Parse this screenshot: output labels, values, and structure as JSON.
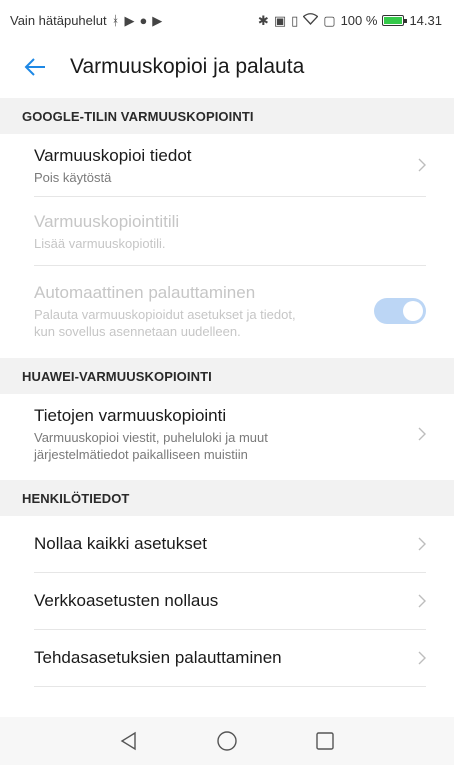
{
  "status_bar": {
    "left_text": "Vain hätäpuhelut",
    "left_icons": [
      "usb-icon",
      "notification-icon",
      "vpn-icon",
      "notification-icon"
    ],
    "right_icons": [
      "bluetooth-icon",
      "nfc-icon",
      "vibrate-icon",
      "wifi-icon",
      "battery-saver-icon"
    ],
    "battery_text": "100 %",
    "battery_color": "#35c94a",
    "time": "14.31"
  },
  "app_bar": {
    "title": "Varmuuskopioi ja palauta",
    "back_icon": "back-arrow-icon",
    "accent": "#1e88e5"
  },
  "sections": [
    {
      "header": "GOOGLE-TILIN VARMUUSKOPIOINTI",
      "items": [
        {
          "title": "Varmuuskopioi tiedot",
          "subtitle": "Pois käytöstä",
          "enabled": true,
          "trailing": "chevron"
        },
        {
          "title": "Varmuuskopiointitili",
          "subtitle": "Lisää varmuuskopiotili.",
          "enabled": false,
          "trailing": "none"
        },
        {
          "title": "Automaattinen palauttaminen",
          "subtitle_line1": "Palauta varmuuskopioidut asetukset ja tiedot,",
          "subtitle_line2": "kun sovellus asennetaan uudelleen.",
          "enabled": false,
          "trailing": "toggle",
          "toggle_on": true
        }
      ]
    },
    {
      "header": "HUAWEI-VARMUUSKOPIOINTI",
      "items": [
        {
          "title": "Tietojen varmuuskopiointi",
          "subtitle_line1": "Varmuuskopioi viestit, puheluloki ja muut",
          "subtitle_line2": "järjestelmätiedot paikalliseen muistiin",
          "enabled": true,
          "trailing": "chevron"
        }
      ]
    },
    {
      "header": "HENKILÖTIEDOT",
      "items": [
        {
          "title": "Nollaa kaikki asetukset",
          "enabled": true,
          "trailing": "chevron"
        },
        {
          "title": "Verkkoasetusten nollaus",
          "enabled": true,
          "trailing": "chevron"
        },
        {
          "title": "Tehdasasetuksien palauttaminen",
          "enabled": true,
          "trailing": "chevron"
        }
      ]
    }
  ],
  "nav_bar": {
    "buttons": [
      "back-triangle-icon",
      "home-circle-icon",
      "recents-square-icon"
    ]
  }
}
